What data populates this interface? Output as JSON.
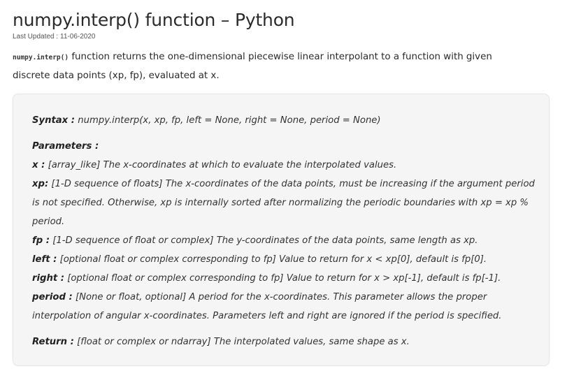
{
  "article": {
    "title": "numpy.interp() function – Python",
    "last_updated_label": "Last Updated :",
    "last_updated_date": "11-06-2020",
    "intro_code": "numpy.interp()",
    "intro_text": " function returns the one-dimensional piecewise linear interpolant to a function with given discrete data points (xp, fp), evaluated at x."
  },
  "syntax_box": {
    "syntax_label": "Syntax :",
    "syntax_text": " numpy.interp(x, xp, fp, left = None, right = None, period = None)",
    "parameters_heading": "Parameters :",
    "params": [
      {
        "name": "x :",
        "desc": " [array_like] The x-coordinates at which to evaluate the interpolated values."
      },
      {
        "name": "xp:",
        "desc": " [1-D sequence of floats] The x-coordinates of the data points, must be increasing if the argument period is not specified. Otherwise, xp is internally sorted after normalizing the periodic boundaries with xp = xp % period."
      },
      {
        "name": "fp :",
        "desc": " [1-D sequence of float or complex] The y-coordinates of the data points, same length as xp."
      },
      {
        "name": "left :",
        "desc": " [optional float or complex corresponding to fp] Value to return for x < xp[0], default is fp[0]."
      },
      {
        "name": "right :",
        "desc": " [optional float or complex corresponding to fp] Value to return for x > xp[-1], default is fp[-1]."
      },
      {
        "name": "period :",
        "desc": " [None or float, optional] A period for the x-coordinates. This parameter allows the proper interpolation of angular x-coordinates. Parameters left and right are ignored if the period is specified."
      }
    ],
    "return_label": "Return :",
    "return_text": " [float or complex or ndarray] The interpolated values, same shape as x."
  }
}
